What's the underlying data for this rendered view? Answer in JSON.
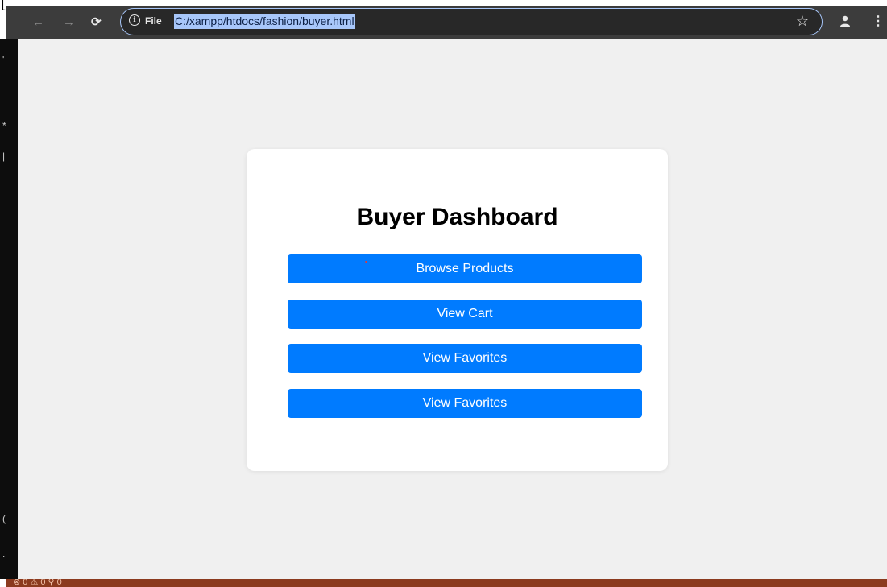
{
  "window": {
    "corner_glyph": "["
  },
  "browser": {
    "back_icon": "back-arrow-icon",
    "forward_icon": "forward-arrow-icon",
    "reload_icon": "reload-icon",
    "site_info_label": "File",
    "url": "C:/xampp/htdocs/fashion/buyer.html",
    "bookmark_icon": "star-icon",
    "profile_icon": "person-icon",
    "menu_icon": "kebab-menu-icon"
  },
  "page": {
    "title": "Buyer Dashboard",
    "buttons": [
      {
        "label": "Browse Products"
      },
      {
        "label": "View Cart"
      },
      {
        "label": "View Favorites"
      },
      {
        "label": "View Favorites"
      }
    ]
  },
  "status_bar": {
    "text": "⊗ 0 ⚠ 0   ⚲ 0"
  },
  "colors": {
    "toolbar": "#3c3c3c",
    "address_selection": "#a8c7fa",
    "page_background": "#f0f0f0",
    "card": "#ffffff",
    "button": "#007bff",
    "button_text": "#ffffff",
    "status_bar": "#8b3a1e"
  }
}
